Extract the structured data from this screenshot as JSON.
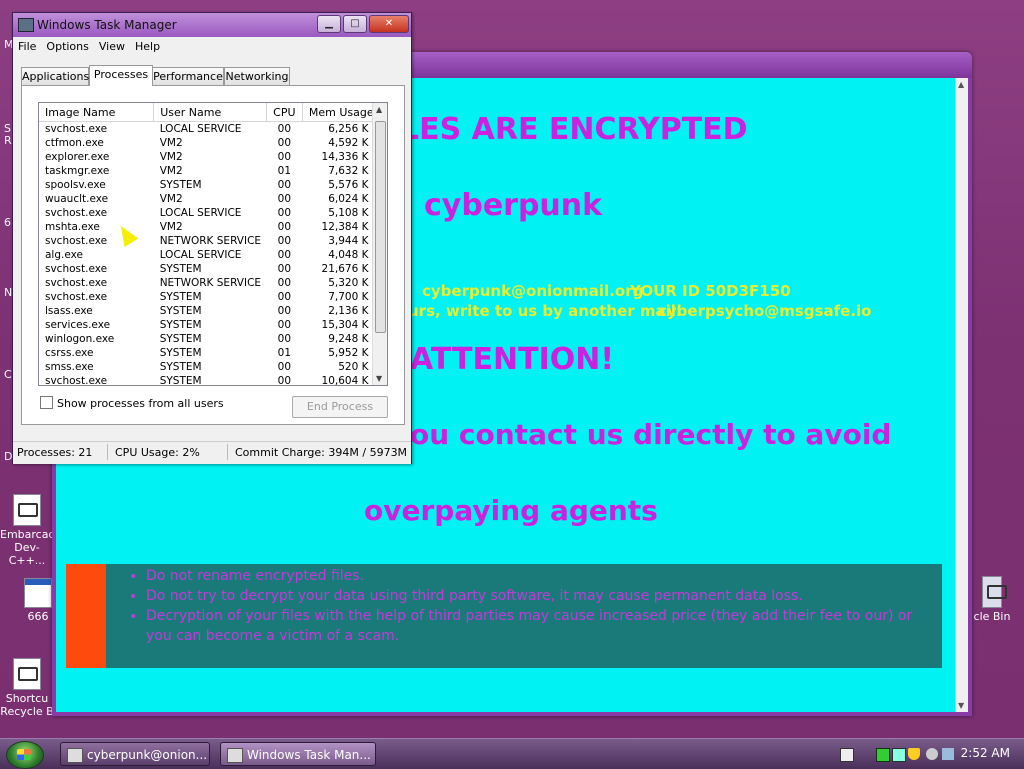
{
  "desktop": {
    "icons": [
      {
        "label": "Embarcad Dev-C++..."
      },
      {
        "label": "666"
      },
      {
        "label": "Shortcu Recycle B"
      },
      {
        "label": "cle Bin"
      }
    ],
    "edge_letters": [
      "M",
      "S",
      "R",
      "6",
      "N",
      "C",
      "D"
    ]
  },
  "ransom": {
    "heading": "LES ARE ENCRYPTED",
    "brand": "cyberpunk",
    "email_line": "cyberpunk@onionmail.org",
    "id_line": "YOUR ID 50D3F150",
    "alt_line_prefix": "urs, write to us by another mail:",
    "alt_email": "cyberpsycho@msgsafe.io",
    "attention": "ATTENTION!",
    "contact_line": "ou contact us directly to avoid",
    "overpaying": "overpaying agents",
    "warnings": [
      "Do not rename encrypted files.",
      "Do not try to decrypt your data using third party software, it may cause permanent data loss.",
      "Decryption of your files with the help of third parties may cause increased price (they add their fee to our) or you can become a victim of a scam."
    ],
    "colors": {
      "background": "#00f2f2",
      "headline": "#cc22e0",
      "highlight": "#e8ee30",
      "warn_box": "#1a7a7a",
      "warn_bar": "#ff4a0e"
    }
  },
  "taskmgr": {
    "title": "Windows Task Manager",
    "menu": [
      "File",
      "Options",
      "View",
      "Help"
    ],
    "tabs": [
      "Applications",
      "Processes",
      "Performance",
      "Networking"
    ],
    "active_tab": "Processes",
    "columns": [
      "Image Name",
      "User Name",
      "CPU",
      "Mem Usage"
    ],
    "rows": [
      [
        "svchost.exe",
        "LOCAL SERVICE",
        "00",
        "6,256 K"
      ],
      [
        "ctfmon.exe",
        "VM2",
        "00",
        "4,592 K"
      ],
      [
        "explorer.exe",
        "VM2",
        "00",
        "14,336 K"
      ],
      [
        "taskmgr.exe",
        "VM2",
        "01",
        "7,632 K"
      ],
      [
        "spoolsv.exe",
        "SYSTEM",
        "00",
        "5,576 K"
      ],
      [
        "wuauclt.exe",
        "VM2",
        "00",
        "6,024 K"
      ],
      [
        "svchost.exe",
        "LOCAL SERVICE",
        "00",
        "5,108 K"
      ],
      [
        "mshta.exe",
        "VM2",
        "00",
        "12,384 K"
      ],
      [
        "svchost.exe",
        "NETWORK SERVICE",
        "00",
        "3,944 K"
      ],
      [
        "alg.exe",
        "LOCAL SERVICE",
        "00",
        "4,048 K"
      ],
      [
        "svchost.exe",
        "SYSTEM",
        "00",
        "21,676 K"
      ],
      [
        "svchost.exe",
        "NETWORK SERVICE",
        "00",
        "5,320 K"
      ],
      [
        "svchost.exe",
        "SYSTEM",
        "00",
        "7,700 K"
      ],
      [
        "lsass.exe",
        "SYSTEM",
        "00",
        "2,136 K"
      ],
      [
        "services.exe",
        "SYSTEM",
        "00",
        "15,304 K"
      ],
      [
        "winlogon.exe",
        "SYSTEM",
        "00",
        "9,248 K"
      ],
      [
        "csrss.exe",
        "SYSTEM",
        "01",
        "5,952 K"
      ],
      [
        "smss.exe",
        "SYSTEM",
        "00",
        "520 K"
      ],
      [
        "svchost.exe",
        "SYSTEM",
        "00",
        "10,604 K"
      ]
    ],
    "show_all_label": "Show processes from all users",
    "end_process_label": "End Process",
    "status": {
      "processes": "Processes: 21",
      "cpu": "CPU Usage: 2%",
      "commit": "Commit Charge: 394M / 5973M"
    }
  },
  "taskbar": {
    "tasks": [
      {
        "label": "cyberpunk@onion...",
        "active": false
      },
      {
        "label": "Windows Task Man...",
        "active": true
      }
    ],
    "clock": "2:52 AM"
  }
}
